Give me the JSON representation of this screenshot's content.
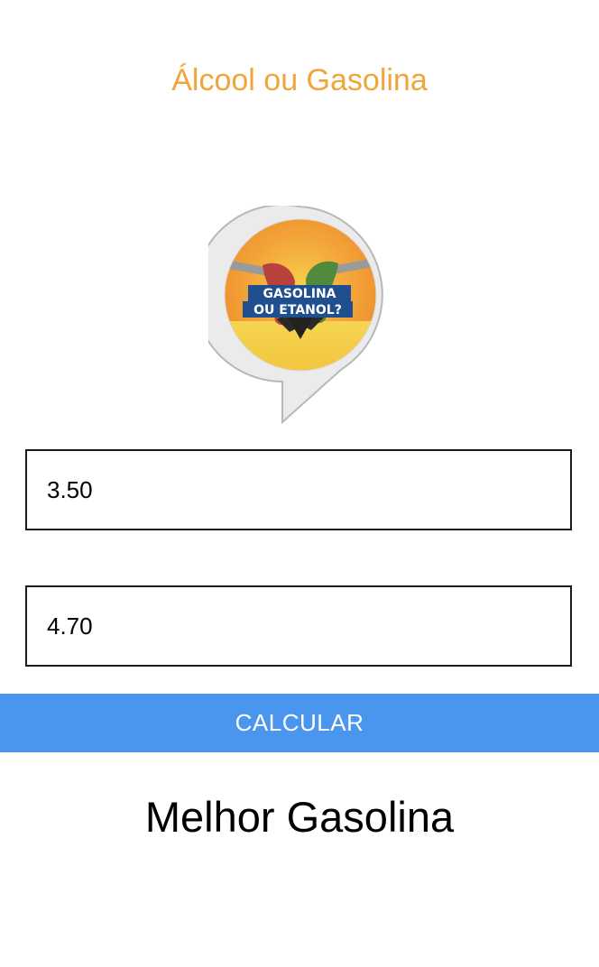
{
  "header": {
    "title": "Álcool ou Gasolina"
  },
  "logo": {
    "icon": "fuel-pump-speech-bubble-icon",
    "line1": "GASOLINA",
    "line2": "OU ETANOL?"
  },
  "form": {
    "alcool_value": "3.50",
    "gasolina_value": "4.70"
  },
  "actions": {
    "calculate_label": "CALCULAR"
  },
  "result": {
    "text": "Melhor Gasolina"
  },
  "colors": {
    "title": "#f0a53a",
    "button": "#4a96ee",
    "button_text": "#ffffff",
    "input_border": "#1a1a1a"
  }
}
